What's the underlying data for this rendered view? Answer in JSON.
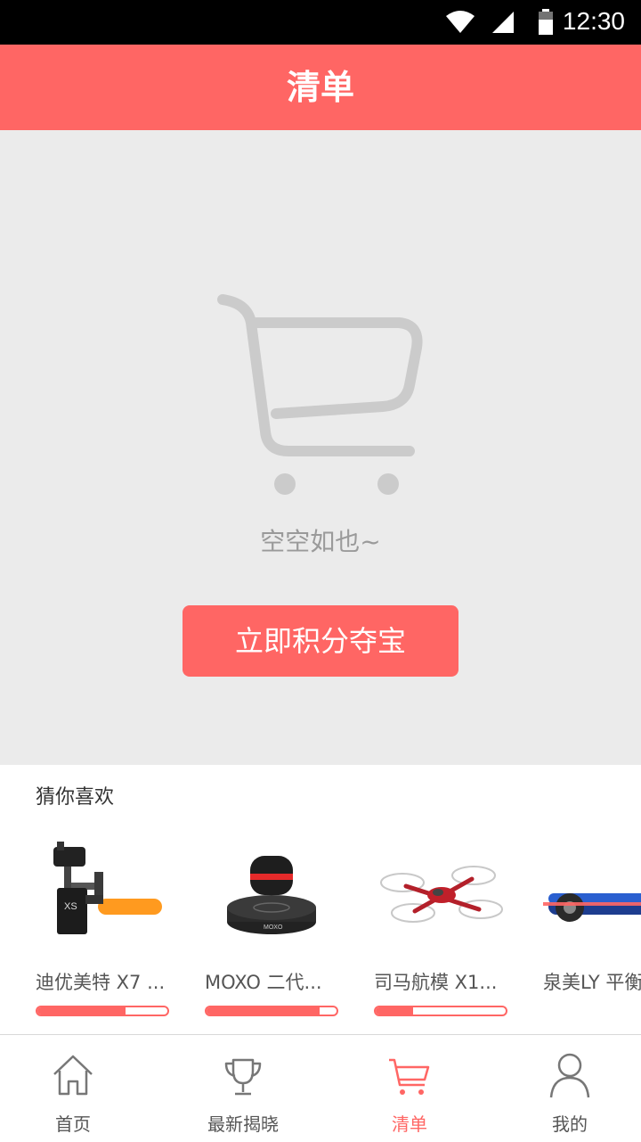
{
  "status_bar": {
    "time": "12:30",
    "icons": [
      "wifi-icon",
      "signal-icon",
      "battery-icon"
    ]
  },
  "header": {
    "title": "清单"
  },
  "empty_state": {
    "icon": "shopping-cart-icon",
    "message": "空空如也~",
    "cta_label": "立即积分夺宝"
  },
  "recommend": {
    "title": "猜你喜欢",
    "products": [
      {
        "name": "迪优美特 X7 ...",
        "progress": 0.68,
        "image": "gimbal-product-image"
      },
      {
        "name": "MOXO 二代...",
        "progress": 0.87,
        "image": "speaker-product-image"
      },
      {
        "name": "司马航模 X1...",
        "progress": 0.29,
        "image": "drone-product-image"
      },
      {
        "name": "泉美LY 平衡...",
        "progress": 0.5,
        "image": "hoverboard-product-image"
      }
    ]
  },
  "tabbar": {
    "items": [
      {
        "label": "首页",
        "icon": "home-icon",
        "active": false
      },
      {
        "label": "最新揭晓",
        "icon": "trophy-icon",
        "active": false
      },
      {
        "label": "清单",
        "icon": "cart-icon",
        "active": true
      },
      {
        "label": "我的",
        "icon": "user-icon",
        "active": false
      }
    ]
  },
  "colors": {
    "accent": "#ff6664",
    "empty_bg": "#ebebeb"
  }
}
